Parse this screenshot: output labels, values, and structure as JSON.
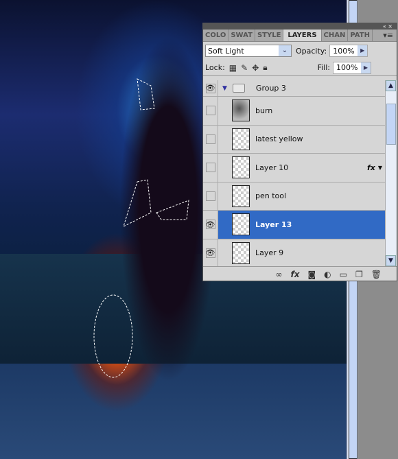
{
  "panel": {
    "tabs": [
      {
        "label": "COLO"
      },
      {
        "label": "SWAT"
      },
      {
        "label": "STYLE"
      },
      {
        "label": "LAYERS",
        "active": true
      },
      {
        "label": "CHAN"
      },
      {
        "label": "PATH"
      }
    ],
    "blend_mode": "Soft Light",
    "opacity_label": "Opacity:",
    "opacity": "100%",
    "lock_label": "Lock:",
    "fill_label": "Fill:",
    "fill": "100%",
    "layers": [
      {
        "name": "Group 3",
        "type": "group",
        "visible": true
      },
      {
        "name": "burn",
        "visible": false
      },
      {
        "name": "latest yellow",
        "visible": false
      },
      {
        "name": "Layer 10",
        "visible": false,
        "fx": "fx"
      },
      {
        "name": "pen tool",
        "visible": false
      },
      {
        "name": "Layer 13",
        "visible": true,
        "selected": true
      },
      {
        "name": "Layer 9",
        "visible": true
      }
    ]
  },
  "colors": {
    "selection": "#316ac5",
    "panel_bg": "#d6d6d6"
  }
}
